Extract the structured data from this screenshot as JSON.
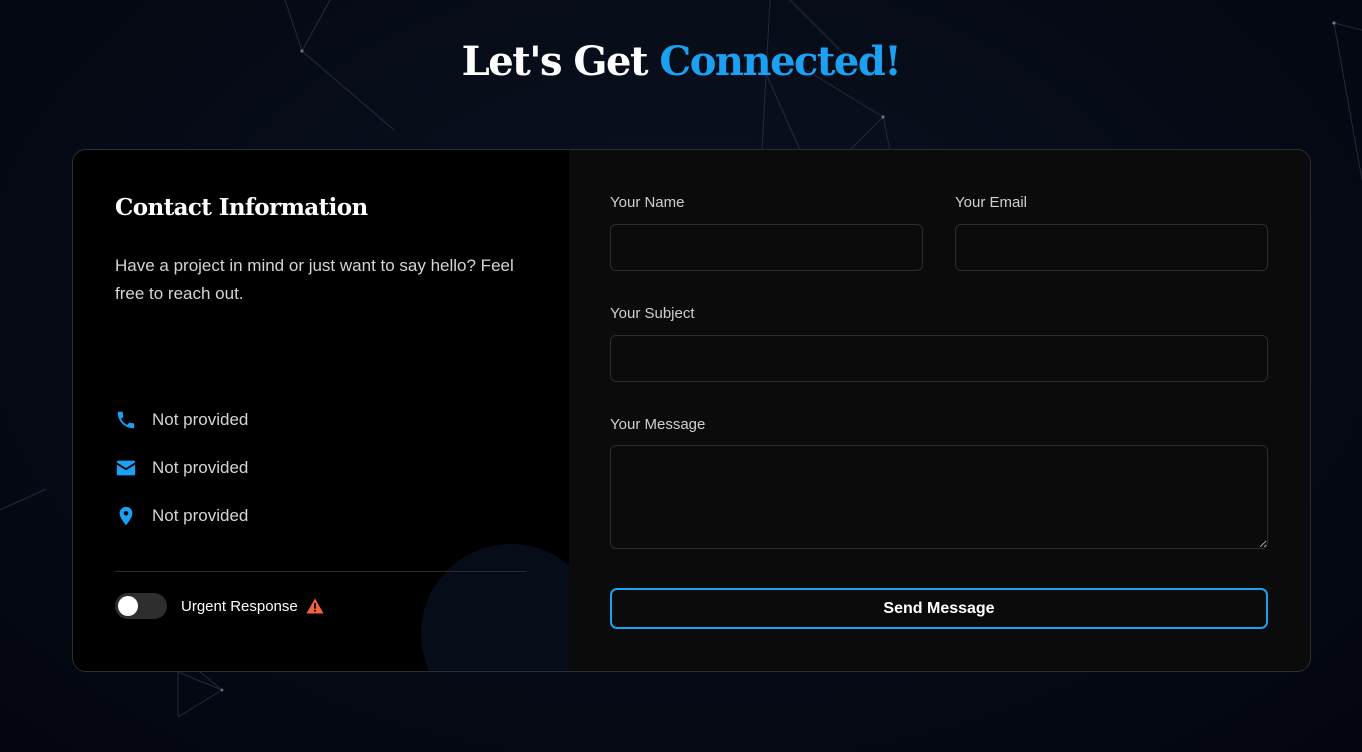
{
  "header": {
    "title_part1": "Let's Get",
    "title_accent": "Connected!"
  },
  "contact_info": {
    "title": "Contact Information",
    "description": "Have a project in mind or just want to say hello? Feel free to reach out.",
    "items": [
      {
        "icon": "phone-icon",
        "text": "Not provided"
      },
      {
        "icon": "email-icon",
        "text": "Not provided"
      },
      {
        "icon": "location-icon",
        "text": "Not provided"
      }
    ],
    "urgent": {
      "label": "Urgent Response",
      "enabled": false,
      "icon": "warning-icon"
    }
  },
  "form": {
    "name_label": "Your Name",
    "name_value": "",
    "email_label": "Your Email",
    "email_value": "",
    "subject_label": "Your Subject",
    "subject_value": "",
    "message_label": "Your Message",
    "message_value": "",
    "submit_label": "Send Message"
  },
  "colors": {
    "accent": "#1ba0f2",
    "background": "#050a16",
    "card": "#0b0b0b",
    "info_panel": "#000000",
    "warning": "#f0643c"
  }
}
